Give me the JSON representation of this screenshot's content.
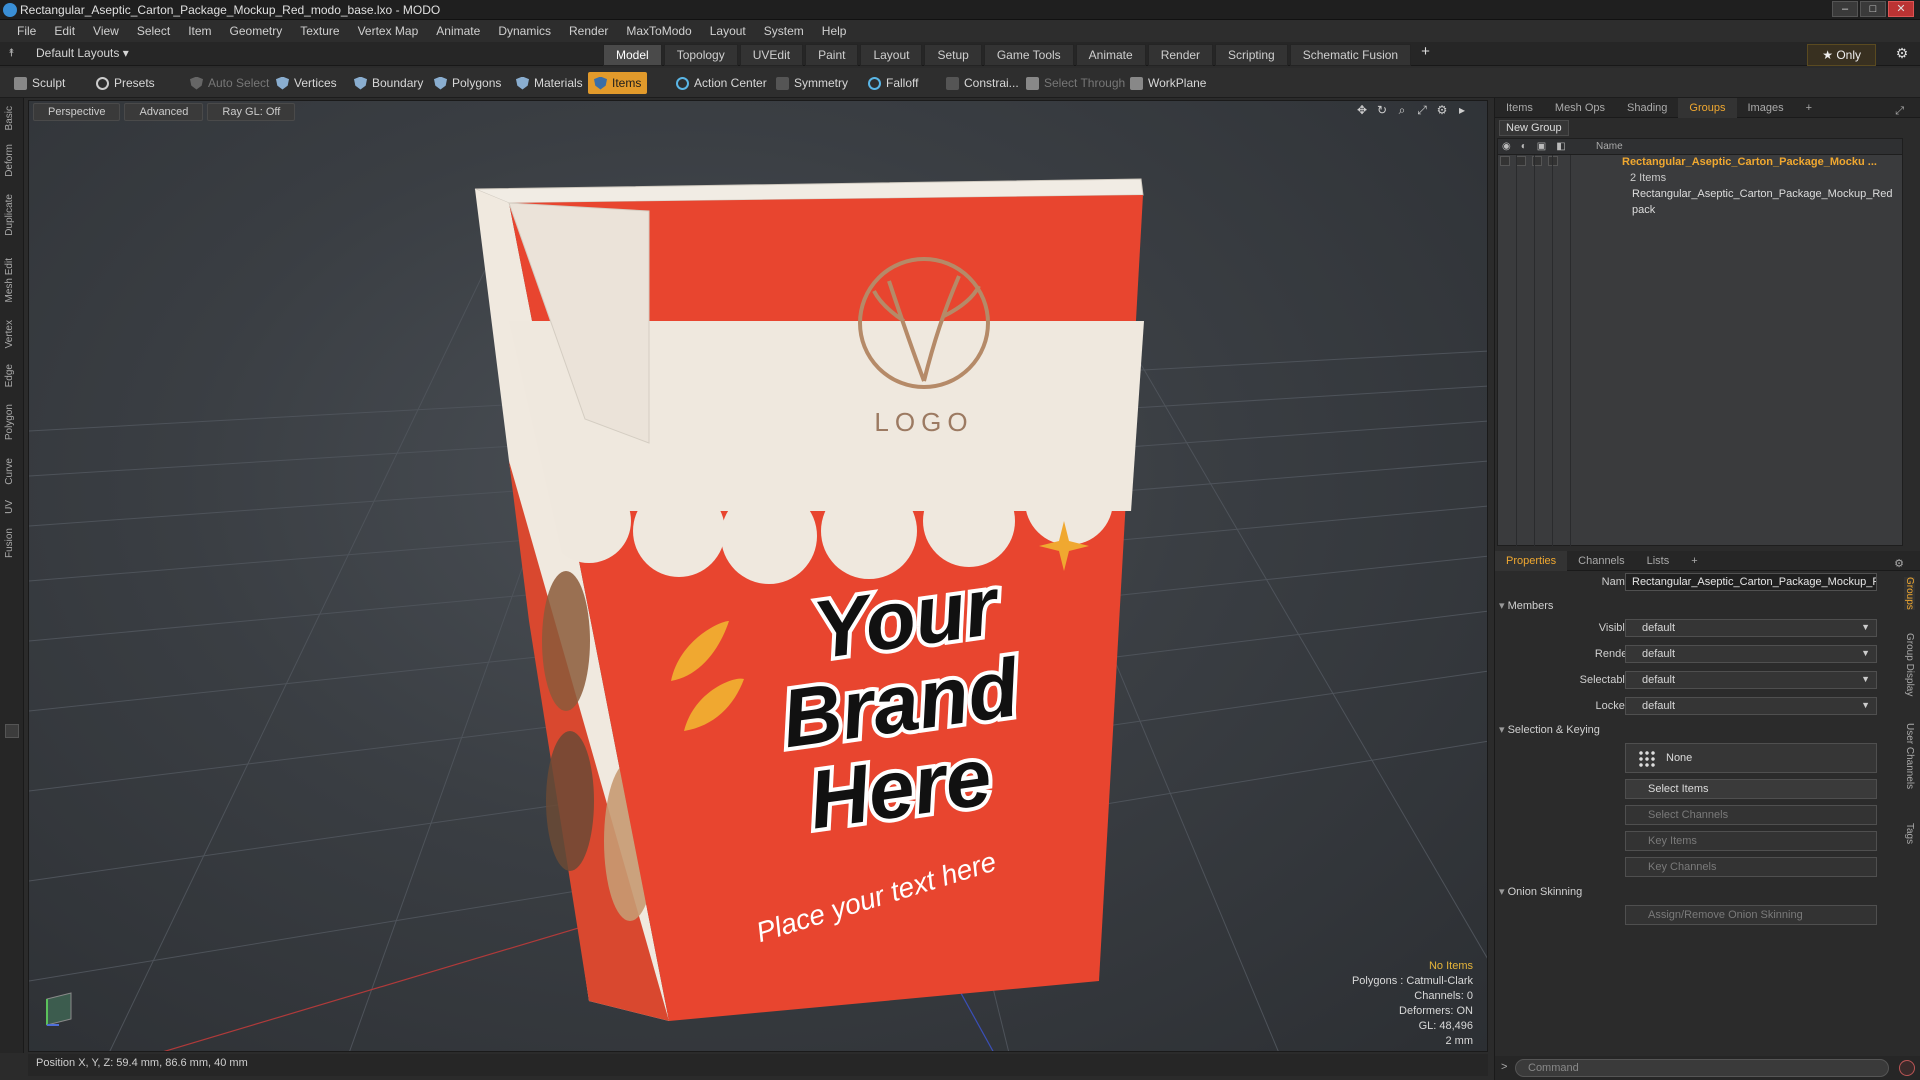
{
  "window": {
    "title": "Rectangular_Aseptic_Carton_Package_Mockup_Red_modo_base.lxo - MODO",
    "controls": {
      "minimize": "–",
      "maximize": "□",
      "close": "✕"
    }
  },
  "menu": [
    "File",
    "Edit",
    "View",
    "Select",
    "Item",
    "Geometry",
    "Texture",
    "Vertex Map",
    "Animate",
    "Dynamics",
    "Render",
    "MaxToModo",
    "Layout",
    "System",
    "Help"
  ],
  "layout_bar": {
    "layouts_label": "Default Layouts ▾",
    "tabs": [
      "Model",
      "Topology",
      "UVEdit",
      "Paint",
      "Layout",
      "Setup",
      "Game Tools",
      "Animate",
      "Render",
      "Scripting",
      "Schematic Fusion"
    ],
    "active_tab": "Model",
    "add_tab": "+",
    "only_label": "★ Only"
  },
  "toolbar": {
    "sculpt": "Sculpt",
    "presets": "Presets",
    "auto_select": "Auto Select",
    "vertices": "Vertices",
    "boundary": "Boundary",
    "polygons": "Polygons",
    "materials": "Materials",
    "items": "Items",
    "action_center": "Action Center",
    "symmetry": "Symmetry",
    "falloff": "Falloff",
    "constraints": "Constrai...",
    "select_through": "Select Through",
    "workplane": "WorkPlane"
  },
  "left_tabs": [
    "Basic",
    "Deform",
    "Duplicate",
    "Mesh Edit",
    "Vertex",
    "Edge",
    "Polygon",
    "Curve",
    "UV",
    "Fusion"
  ],
  "viewport": {
    "view_mode": "Perspective",
    "shading": "Advanced",
    "raygl": "Ray GL: Off",
    "controls": [
      "✥",
      "↻",
      "⌕",
      "⤢",
      "⚙",
      "▸"
    ],
    "product": {
      "logo_text": "LOGO",
      "brand_lines": [
        "Your",
        "Brand",
        "Here"
      ],
      "tagline": "Place your text here"
    },
    "stats": {
      "no_items": "No Items",
      "polygons": "Polygons : Catmull-Clark",
      "channels": "Channels: 0",
      "deformers": "Deformers: ON",
      "gl": "GL: 48,496",
      "grid": "2 mm"
    }
  },
  "status_bar": {
    "position": "Position X, Y, Z:  59.4 mm, 86.6 mm, 40 mm"
  },
  "colors": {
    "accent": "#f0a830",
    "carton_red": "#e8452f",
    "carton_cream": "#ede6dc",
    "logo_tan": "#b58a68"
  },
  "panel_top": {
    "tabs": [
      "Items",
      "Mesh Ops",
      "Shading",
      "Groups",
      "Images"
    ],
    "active_tab": "Groups",
    "add_tab": "+",
    "new_group": "New Group",
    "header_name": "Name",
    "rows": [
      {
        "label": "Rectangular_Aseptic_Carton_Package_Mocku ...",
        "type": "group"
      },
      {
        "label": "2 Items",
        "type": "count"
      },
      {
        "label": "Rectangular_Aseptic_Carton_Package_Mockup_Red",
        "type": "locator"
      },
      {
        "label": "pack",
        "type": "mesh"
      }
    ]
  },
  "panel_bottom": {
    "tabs": [
      "Properties",
      "Channels",
      "Lists"
    ],
    "active_tab": "Properties",
    "add_tab": "+",
    "side_tabs": [
      "Groups",
      "Group Display",
      "User Channels",
      "Tags"
    ],
    "name_label": "Name",
    "name_value": "Rectangular_Aseptic_Carton_Package_Mockup_Red",
    "members_section": "Members",
    "members": [
      {
        "label": "Visible",
        "value": "default"
      },
      {
        "label": "Render",
        "value": "default"
      },
      {
        "label": "Selectable",
        "value": "default"
      },
      {
        "label": "Locked",
        "value": "default"
      }
    ],
    "selection_section": "Selection & Keying",
    "none_button": "None",
    "select_items": "Select Items",
    "select_channels": "Select Channels",
    "key_items": "Key Items",
    "key_channels": "Key Channels",
    "onion_section": "Onion Skinning",
    "onion_button": "Assign/Remove Onion Skinning"
  },
  "command": {
    "placeholder": "Command",
    "prompt": ">"
  }
}
